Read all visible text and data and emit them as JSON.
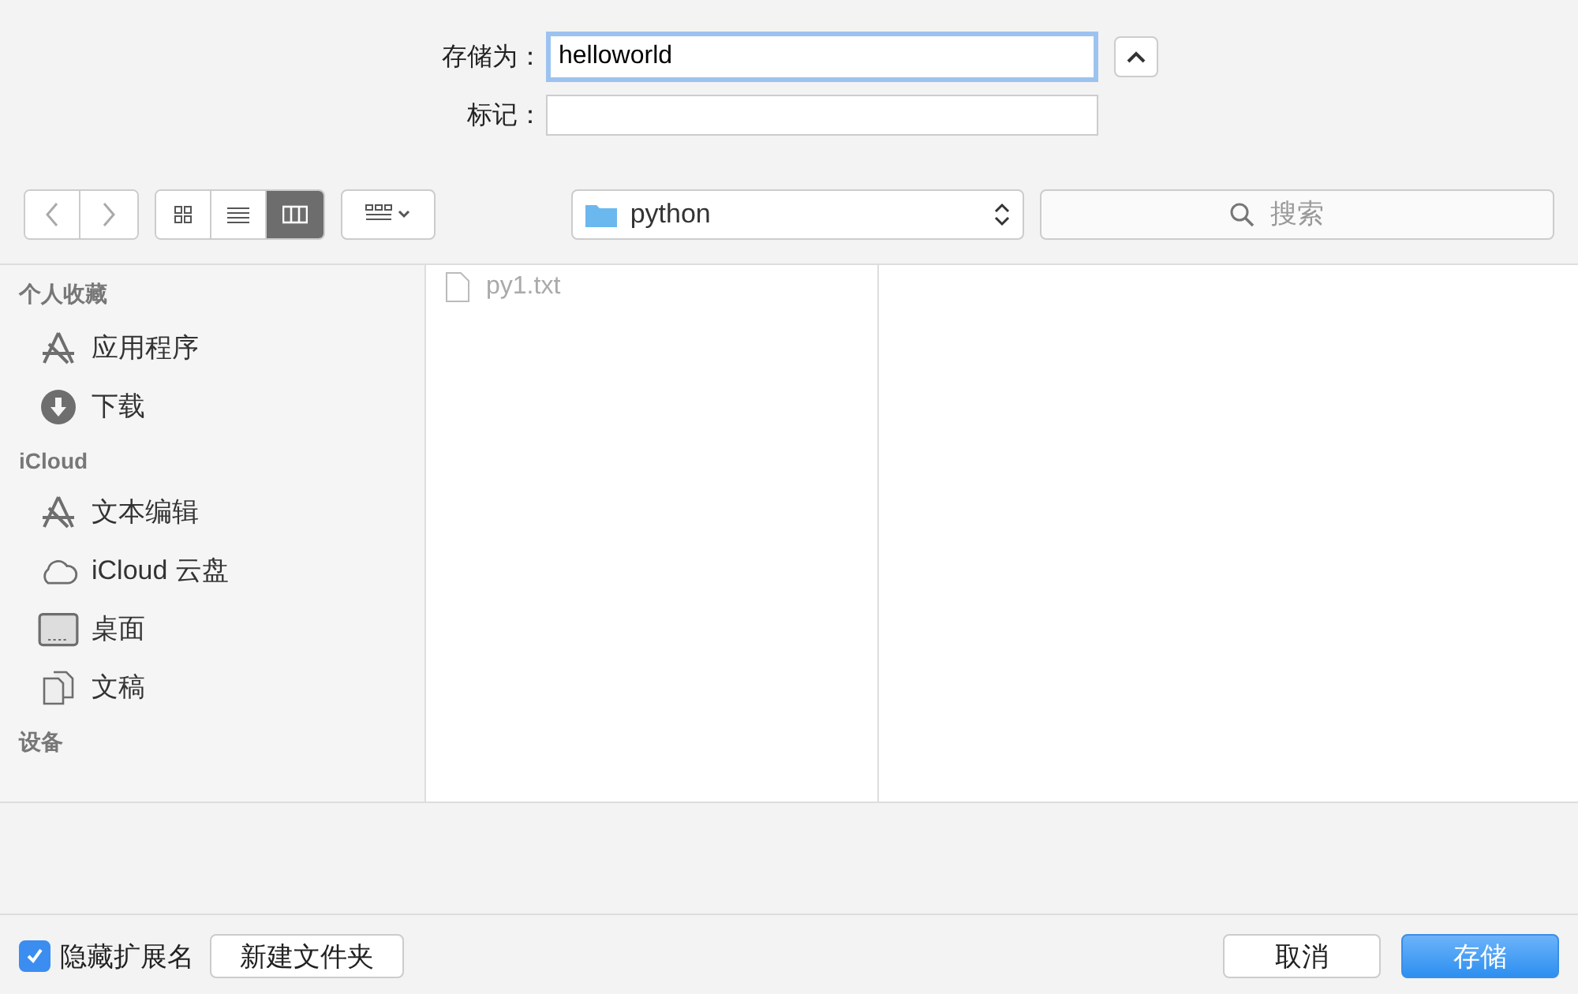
{
  "save_as": {
    "label": "存储为：",
    "value": "helloworld"
  },
  "tags": {
    "label": "标记："
  },
  "view_modes": [
    {
      "kind": "icons",
      "selected": false
    },
    {
      "kind": "list",
      "selected": false
    },
    {
      "kind": "columns",
      "selected": true
    }
  ],
  "location": {
    "label": "python"
  },
  "search": {
    "placeholder": "搜索"
  },
  "sidebar": [
    {
      "title": "个人收藏",
      "items": [
        {
          "label": "应用程序",
          "kind": "apps"
        },
        {
          "label": "下载",
          "kind": "download"
        }
      ]
    },
    {
      "title": "iCloud",
      "items": [
        {
          "label": "文本编辑",
          "kind": "apps"
        },
        {
          "label": "iCloud 云盘",
          "kind": "cloud"
        },
        {
          "label": "桌面",
          "kind": "desktop"
        },
        {
          "label": "文稿",
          "kind": "documents"
        }
      ]
    },
    {
      "title": "设备"
    }
  ],
  "files": [
    {
      "name": "py1.txt",
      "disabled": true
    }
  ],
  "hide_extension": {
    "label": "隐藏扩展名",
    "checked": true
  },
  "new_folder_button": "新建文件夹",
  "buttons": [
    {
      "label": "取消",
      "kind": "secondary"
    },
    {
      "label": "存储",
      "kind": "default"
    }
  ]
}
